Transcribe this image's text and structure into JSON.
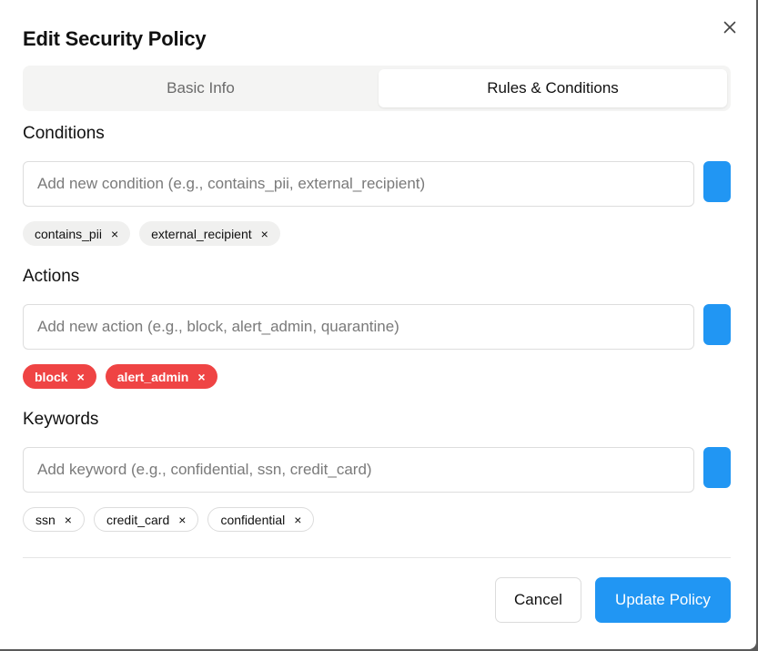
{
  "dialog": {
    "title": "Edit Security Policy",
    "close_icon": "close-icon"
  },
  "tabs": [
    {
      "label": "Basic Info",
      "active": false
    },
    {
      "label": "Rules & Conditions",
      "active": true
    }
  ],
  "conditions": {
    "label": "Conditions",
    "placeholder": "Add new condition (e.g., contains_pii, external_recipient)",
    "value": "",
    "chips": [
      "contains_pii",
      "external_recipient"
    ]
  },
  "actions": {
    "label": "Actions",
    "placeholder": "Add new action (e.g., block, alert_admin, quarantine)",
    "value": "",
    "chips": [
      "block",
      "alert_admin"
    ]
  },
  "keywords": {
    "label": "Keywords",
    "placeholder": "Add keyword (e.g., confidential, ssn, credit_card)",
    "value": "",
    "chips": [
      "ssn",
      "credit_card",
      "confidential"
    ]
  },
  "chip_remove_symbol": "×",
  "footer": {
    "cancel_label": "Cancel",
    "update_label": "Update Policy"
  },
  "colors": {
    "accent": "#2196f3",
    "action_chip": "#ef4444",
    "tab_bar": "#f4f4f3"
  }
}
